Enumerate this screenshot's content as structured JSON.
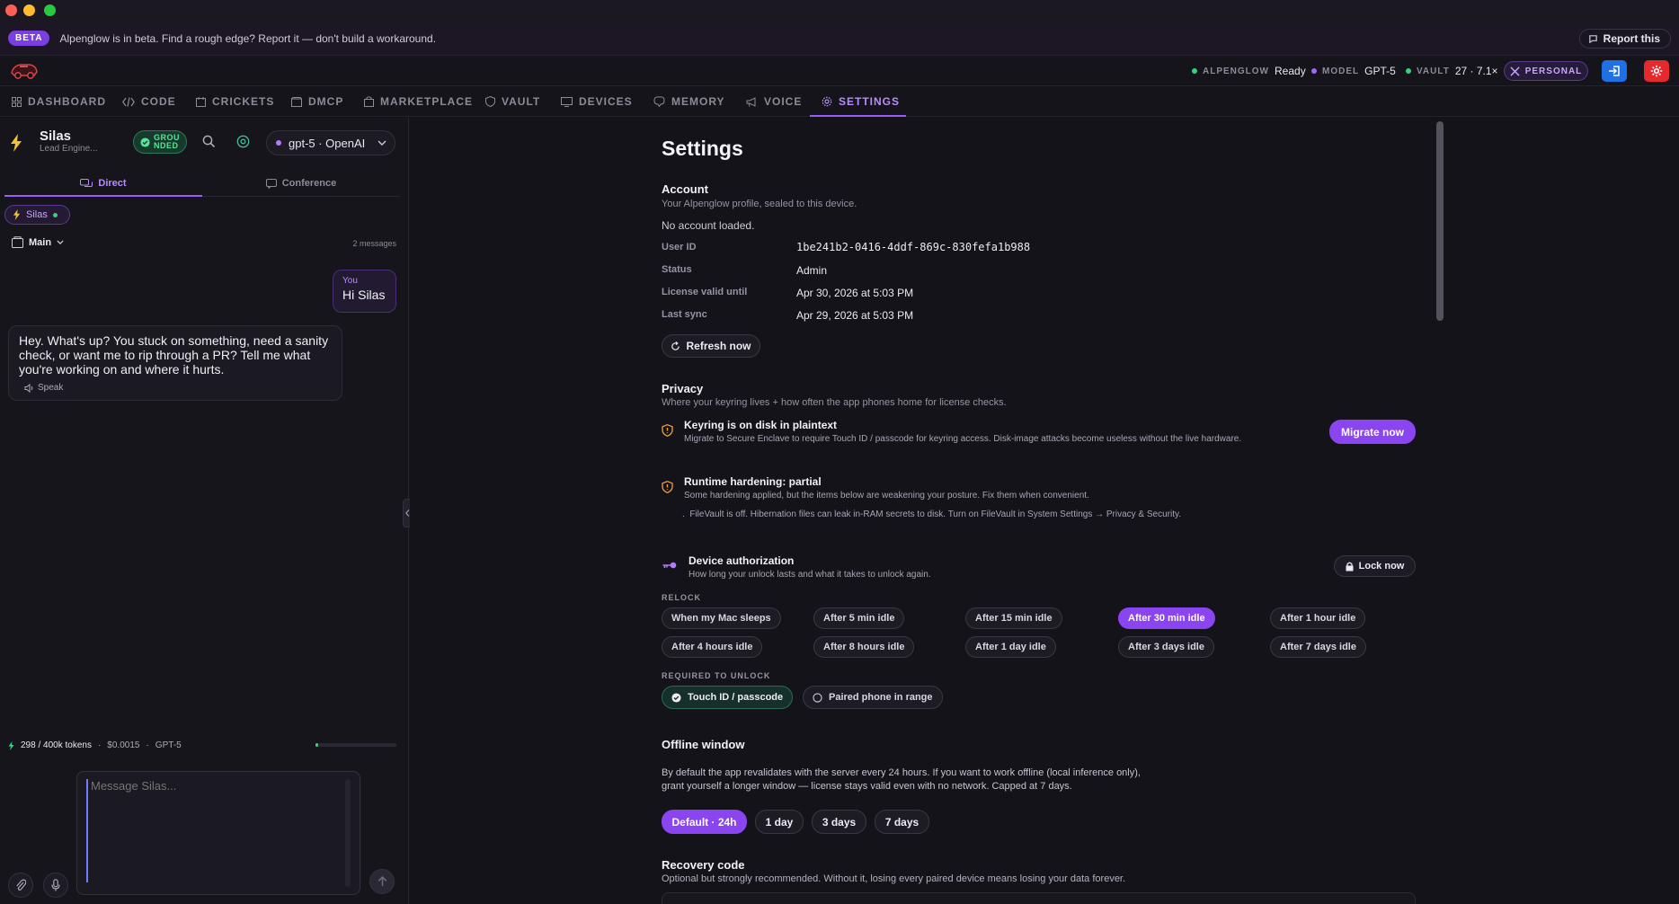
{
  "banner": {
    "badge": "BETA",
    "text": "Alpenglow is in beta. Find a rough edge? Report it — don't build a workaround.",
    "report_label": "Report this"
  },
  "header": {
    "status": [
      {
        "key": "ALPENGLOW",
        "value": "Ready",
        "color": "#2fd67a"
      },
      {
        "key": "MODEL",
        "value": "GPT-5",
        "color": "#a365ff"
      },
      {
        "key": "VAULT",
        "value": "27 · 7.1×",
        "color": "#2fd67a"
      }
    ],
    "profile_label": "PERSONAL",
    "colors": {
      "accent": "#9b5cf6",
      "signin_button": "#1f6fe5",
      "settings_button": "#e5292d"
    }
  },
  "nav": {
    "tabs": [
      {
        "label": "DASHBOARD",
        "icon": "grid-icon"
      },
      {
        "label": "CODE",
        "icon": "code-icon"
      },
      {
        "label": "CRICKETS",
        "icon": "calendar-icon"
      },
      {
        "label": "DMCP",
        "icon": "box-icon"
      },
      {
        "label": "MARKETPLACE",
        "icon": "bag-icon"
      },
      {
        "label": "VAULT",
        "icon": "shield-icon"
      },
      {
        "label": "DEVICES",
        "icon": "monitor-icon"
      },
      {
        "label": "MEMORY",
        "icon": "brain-icon"
      },
      {
        "label": "VOICE",
        "icon": "megaphone-icon"
      },
      {
        "label": "SETTINGS",
        "icon": "gear-icon"
      }
    ],
    "active": "SETTINGS"
  },
  "chat": {
    "agent_name": "Silas",
    "agent_role": "Lead Engine...",
    "grounded_line1": "GROU",
    "grounded_line2": "NDED",
    "model_label": "gpt-5 · OpenAI",
    "tabs": {
      "direct": "Direct",
      "conference": "Conference"
    },
    "chip": "Silas",
    "branch": "Main",
    "message_count": "2 messages",
    "user_label": "You",
    "user_message": "Hi Silas",
    "ai_message": "Hey. What's up? You stuck on something, need a sanity check, or want me to rip through a PR? Tell me what you're working on and where it hurts.",
    "speak_label": "Speak",
    "tokens": "298 / 400k tokens",
    "cost": "$0.0015",
    "model_short": "GPT-5",
    "token_fraction": 0.00745,
    "input_placeholder": "Message Silas..."
  },
  "settings": {
    "title": "Settings",
    "account": {
      "title": "Account",
      "subtitle": "Your Alpenglow profile, sealed to this device.",
      "empty": "No account loaded.",
      "fields": [
        {
          "key": "User ID",
          "value": "1be241b2-0416-4ddf-869c-830fefa1b988"
        },
        {
          "key": "Status",
          "value": "Admin"
        },
        {
          "key": "License valid until",
          "value": "Apr 30, 2026 at 5:03 PM"
        },
        {
          "key": "Last sync",
          "value": "Apr 29, 2026 at 5:03 PM"
        }
      ],
      "refresh_label": "Refresh now"
    },
    "privacy": {
      "title": "Privacy",
      "subtitle": "Where your keyring lives + how often the app phones home for license checks.",
      "keyring_title": "Keyring is on disk in plaintext",
      "keyring_body": "Migrate to Secure Enclave to require Touch ID / passcode for keyring access. Disk-image attacks become useless without the live hardware.",
      "migrate_label": "Migrate now",
      "hardening_title": "Runtime hardening: partial",
      "hardening_body": "Some hardening applied, but the items below are weakening your posture. Fix them when convenient.",
      "hardening_item": "FileVault is off. Hibernation files can leak in-RAM secrets to disk. Turn on FileVault in System Settings → Privacy & Security."
    },
    "device": {
      "title": "Device authorization",
      "subtitle": "How long your unlock lasts and what it takes to unlock again.",
      "lock_label": "Lock now",
      "relock_label": "RELOCK",
      "relock_options": [
        "When my Mac sleeps",
        "After 5 min idle",
        "After 15 min idle",
        "After 30 min idle",
        "After 1 hour idle",
        "After 4 hours idle",
        "After 8 hours idle",
        "After 1 day idle",
        "After 3 days idle",
        "After 7 days idle"
      ],
      "relock_selected": "After 30 min idle",
      "unlock_label": "REQUIRED TO UNLOCK",
      "unlock_options": [
        "Touch ID / passcode",
        "Paired phone in range"
      ],
      "unlock_selected": "Touch ID / passcode"
    },
    "offline": {
      "title": "Offline window",
      "body_line1": "By default the app revalidates with the server every 24 hours. If you want to work offline (local inference only),",
      "body_line2": "grant yourself a longer window — license stays valid even with no network. Capped at 7 days.",
      "options": [
        "Default · 24h",
        "1 day",
        "3 days",
        "7 days"
      ],
      "selected": "Default · 24h"
    },
    "recovery": {
      "title": "Recovery code",
      "subtitle": "Optional but strongly recommended. Without it, losing every paired device means losing your data forever."
    }
  }
}
